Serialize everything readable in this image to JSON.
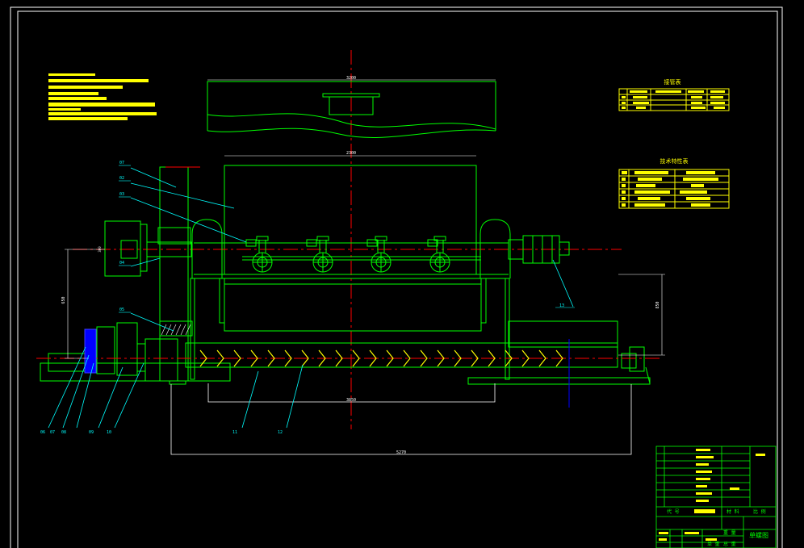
{
  "colors": {
    "background": "#000000",
    "frame": "#ffffff",
    "outline": "#00ff00",
    "centerline": "#ff0000",
    "leader": "#00ffff",
    "notes": "#ffff00",
    "motor": "#0000ff"
  },
  "dimensions": {
    "top_width": "3200",
    "body_width": "2300",
    "vertical_left": "650",
    "vertical_right": "850",
    "bottom_inner": "3850",
    "bottom_overall": "5270",
    "small_mark": "300"
  },
  "callouts": [
    "07",
    "02",
    "03",
    "04",
    "05",
    "06",
    "07",
    "08",
    "09",
    "10",
    "11",
    "12",
    "13"
  ],
  "tables": {
    "upper_title": "接管表",
    "lower_title": "技术特性表"
  },
  "title_block": {
    "label_code": "代 号",
    "label_material": "材 料",
    "label_scale": "比 例",
    "label_weight": "重 量",
    "label_single": "单 重",
    "label_total": "总 重",
    "drawing_name": "单螺图"
  }
}
